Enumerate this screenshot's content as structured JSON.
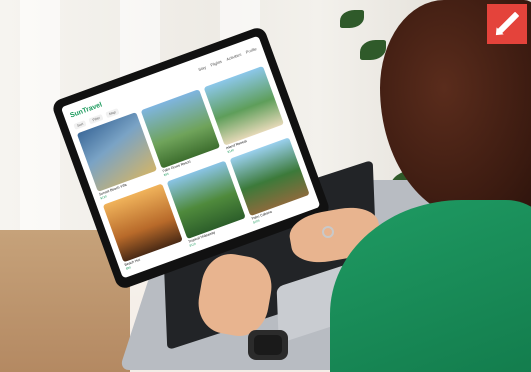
{
  "app": {
    "logo": "SunTravel",
    "nav": [
      "Stay",
      "Flights",
      "Activities",
      "Profile"
    ],
    "filters": [
      "Sort",
      "Filter",
      "Map"
    ]
  },
  "cards": [
    {
      "title": "Sunset Beach Villa",
      "price": "$120"
    },
    {
      "title": "Palm Grove Resort",
      "price": "$95"
    },
    {
      "title": "Island Retreat",
      "price": "$140"
    },
    {
      "title": "Beach Hut",
      "price": "$80"
    },
    {
      "title": "Tropical Hideaway",
      "price": "$110"
    },
    {
      "title": "Palm Cabana",
      "price": "$105"
    }
  ],
  "colors": {
    "brand": "#1a9a5c",
    "badge": "#e4433b",
    "shirt": "#1a8f5a"
  },
  "icons": {
    "badge": "pencil-icon"
  }
}
